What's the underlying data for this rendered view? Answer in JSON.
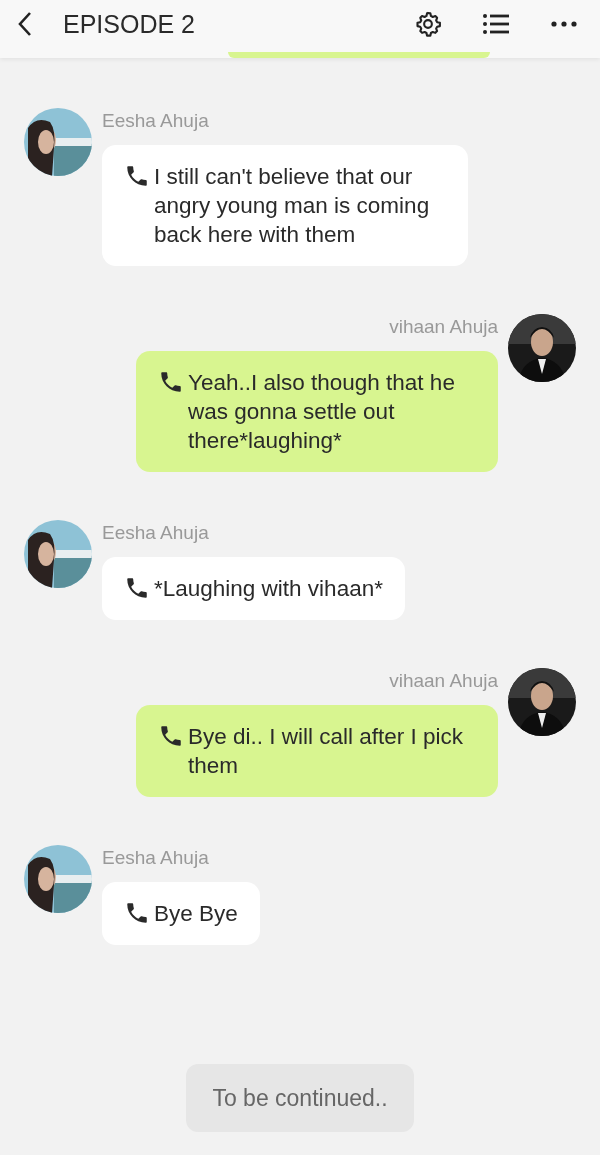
{
  "header": {
    "title": "EPISODE 2"
  },
  "messages": [
    {
      "kind": "incoming",
      "sender": "Eesha Ahuja",
      "text": "I still can't believe that our angry young man is coming back here with them"
    },
    {
      "kind": "outgoing",
      "sender": "vihaan Ahuja",
      "text": "Yeah..I also though that he was gonna settle out there*laughing*"
    },
    {
      "kind": "incoming",
      "sender": "Eesha Ahuja",
      "text": "*Laughing with vihaan*"
    },
    {
      "kind": "outgoing",
      "sender": "vihaan Ahuja",
      "text": "Bye di.. I will call after I pick them"
    },
    {
      "kind": "incoming",
      "sender": "Eesha Ahuja",
      "text": "Bye Bye"
    }
  ],
  "footer": "To be continued.."
}
